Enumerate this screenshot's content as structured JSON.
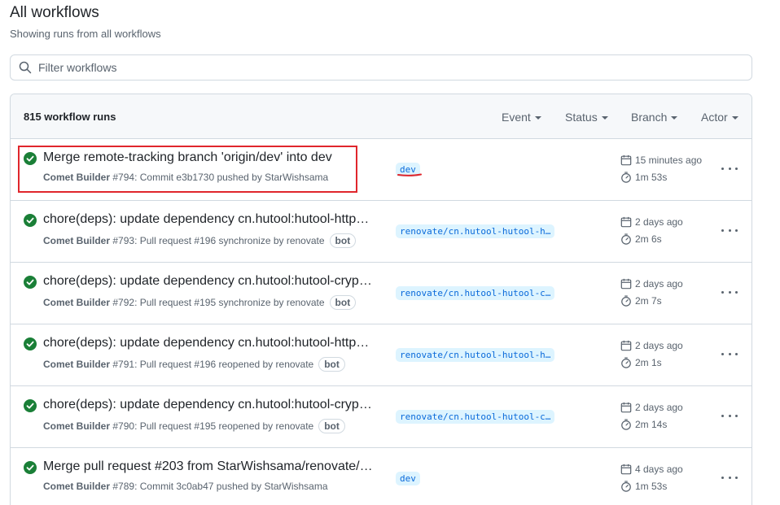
{
  "header": {
    "title": "All workflows",
    "subtitle": "Showing runs from all workflows"
  },
  "filter": {
    "placeholder": "Filter workflows",
    "value": ""
  },
  "runs_header": {
    "count_label": "815 workflow runs",
    "filters": [
      "Event",
      "Status",
      "Branch",
      "Actor"
    ]
  },
  "runs": [
    {
      "title": "Merge remote-tracking branch 'origin/dev' into dev",
      "workflow": "Comet Builder",
      "run_number": "#794",
      "detail": ": Commit e3b1730 pushed by StarWishsama",
      "bot": "",
      "branch": "dev",
      "date": "15 minutes ago",
      "duration": "1m 53s",
      "status": "success"
    },
    {
      "title": "chore(deps): update dependency cn.hutool:hutool-http…",
      "workflow": "Comet Builder",
      "run_number": "#793",
      "detail": ": Pull request #196 synchronize by renovate",
      "bot": "bot",
      "branch": "renovate/cn.hutool-hutool-h…",
      "date": "2 days ago",
      "duration": "2m 6s",
      "status": "success"
    },
    {
      "title": "chore(deps): update dependency cn.hutool:hutool-cryp…",
      "workflow": "Comet Builder",
      "run_number": "#792",
      "detail": ": Pull request #195 synchronize by renovate",
      "bot": "bot",
      "branch": "renovate/cn.hutool-hutool-c…",
      "date": "2 days ago",
      "duration": "2m 7s",
      "status": "success"
    },
    {
      "title": "chore(deps): update dependency cn.hutool:hutool-http…",
      "workflow": "Comet Builder",
      "run_number": "#791",
      "detail": ": Pull request #196 reopened by renovate",
      "bot": "bot",
      "branch": "renovate/cn.hutool-hutool-h…",
      "date": "2 days ago",
      "duration": "2m 1s",
      "status": "success"
    },
    {
      "title": "chore(deps): update dependency cn.hutool:hutool-cryp…",
      "workflow": "Comet Builder",
      "run_number": "#790",
      "detail": ": Pull request #195 reopened by renovate",
      "bot": "bot",
      "branch": "renovate/cn.hutool-hutool-c…",
      "date": "2 days ago",
      "duration": "2m 14s",
      "status": "success"
    },
    {
      "title": "Merge pull request #203 from StarWishsama/renovate/…",
      "workflow": "Comet Builder",
      "run_number": "#789",
      "detail": ": Commit 3c0ab47 pushed by StarWishsama",
      "bot": "",
      "branch": "dev",
      "date": "4 days ago",
      "duration": "1m 53s",
      "status": "success"
    }
  ],
  "colors": {
    "success": "#1a7f37",
    "branch_text": "#0969da",
    "branch_bg": "#ddf4ff",
    "annotation": "#e0262c"
  }
}
